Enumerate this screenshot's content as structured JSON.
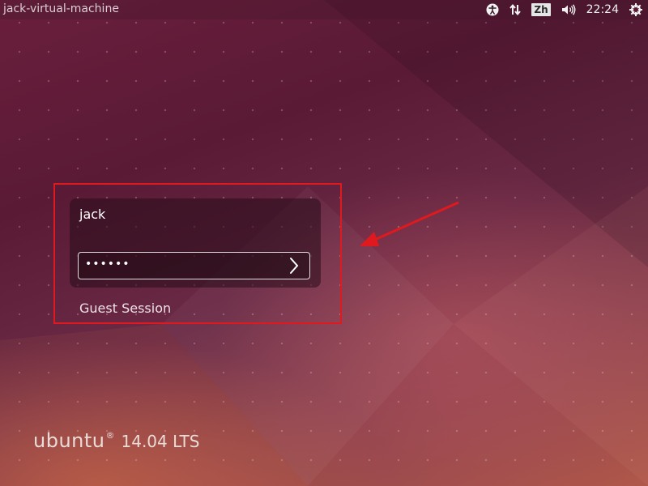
{
  "panel": {
    "hostname": "jack-virtual-machine",
    "language": "Zh",
    "time": "22:24",
    "icons": [
      "accessibility-icon",
      "network-icon",
      "keyboard-language-icon",
      "volume-icon",
      "power-icon"
    ]
  },
  "login": {
    "username": "jack",
    "password_masked": "••••••",
    "guest_label": "Guest Session"
  },
  "branding": {
    "name": "ubuntu",
    "mark": "®",
    "version": "14.04 LTS"
  },
  "colors": {
    "highlight": "#e0191f",
    "background_top": "#5a1a36",
    "background_bottom": "#b0584a"
  }
}
